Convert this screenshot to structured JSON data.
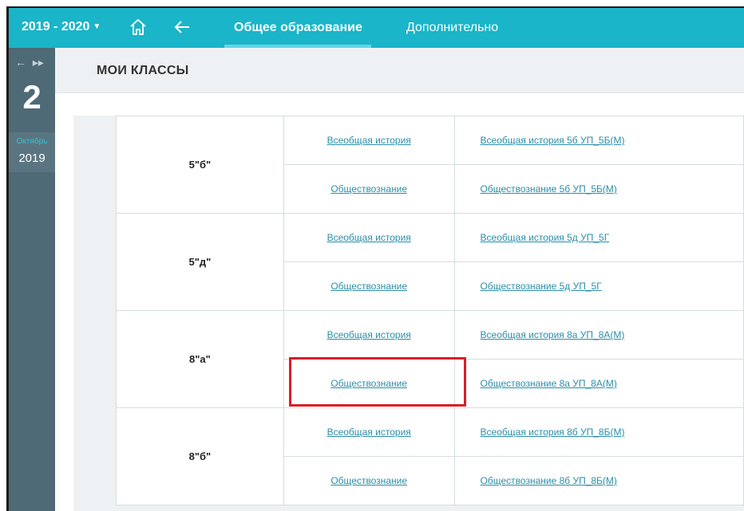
{
  "topbar": {
    "year": "2019 - 2020",
    "tabs": [
      {
        "label": "Общее образование",
        "active": true
      },
      {
        "label": "Дополнительно",
        "active": false
      }
    ]
  },
  "sidebar": {
    "day": "2",
    "month": "Октябрь",
    "year": "2019"
  },
  "page": {
    "title": "МОИ КЛАССЫ"
  },
  "classes": [
    {
      "name": "5\"б\"",
      "rows": [
        {
          "subject": "Всеобщая история",
          "course": "Всеобщая история 5б УП_5Б(М)"
        },
        {
          "subject": "Обществознание",
          "course": "Обществознание 5б УП_5Б(М)"
        }
      ]
    },
    {
      "name": "5\"д\"",
      "rows": [
        {
          "subject": "Всеобщая история",
          "course": "Всеобщая история 5д УП_5Г"
        },
        {
          "subject": "Обществознание",
          "course": "Обществознание 5д УП_5Г"
        }
      ]
    },
    {
      "name": "8\"а\"",
      "rows": [
        {
          "subject": "Всеобщая история",
          "course": "Всеобщая история 8а УП_8А(М)"
        },
        {
          "subject": "Обществознание",
          "course": "Обществознание 8а УП_8А(М)"
        }
      ]
    },
    {
      "name": "8\"б\"",
      "rows": [
        {
          "subject": "Всеобщая история",
          "course": "Всеобщая история 8б УП_8Б(М)"
        },
        {
          "subject": "Обществознание",
          "course": "Обществознание 8б УП_8Б(М)"
        }
      ]
    }
  ],
  "colors": {
    "topbar": "#1ab5c8",
    "sidebar": "#4e6a76",
    "link": "#2b8ea8",
    "highlight": "#d91e28"
  }
}
